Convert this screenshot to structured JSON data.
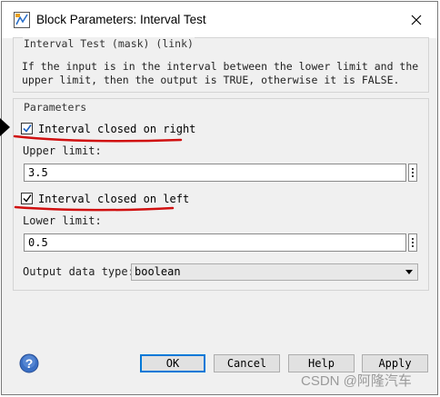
{
  "window": {
    "title": "Block Parameters: Interval Test"
  },
  "description": {
    "group_title": "Interval Test (mask) (link)",
    "text": "If the input is in the interval between the lower limit and the upper limit, then the output is TRUE, otherwise it is FALSE."
  },
  "parameters": {
    "group_title": "Parameters",
    "closed_right": {
      "label": "Interval closed on right",
      "checked": true
    },
    "upper_limit": {
      "label": "Upper limit:",
      "value": "3.5"
    },
    "closed_left": {
      "label": "Interval closed on left",
      "checked": true
    },
    "lower_limit": {
      "label": "Lower limit:",
      "value": "0.5"
    },
    "output_type": {
      "label": "Output data type:",
      "value": "boolean"
    }
  },
  "buttons": {
    "ok": "OK",
    "cancel": "Cancel",
    "help": "Help",
    "apply": "Apply"
  },
  "watermark": "CSDN @阿隆汽车",
  "colors": {
    "annotation_red": "#d01010",
    "default_button_border": "#0078d7",
    "dialog_bg": "#f0f0f0"
  },
  "icons": [
    "simulink-block-icon",
    "close-icon",
    "checkmark-icon",
    "ellipsis-icon",
    "dropdown-arrow-icon",
    "help-icon",
    "pointer-arrow-icon"
  ]
}
